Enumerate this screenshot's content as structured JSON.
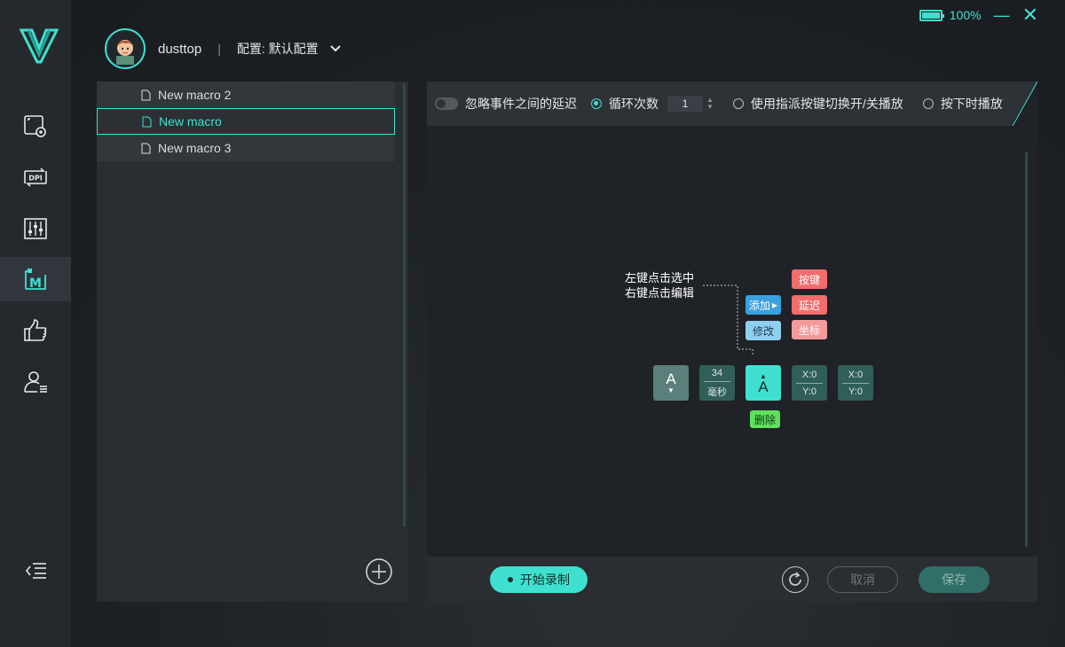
{
  "app": {
    "battery_percent": 100,
    "battery_label": "100%",
    "minimize_icon": "minimize-icon",
    "close_icon": "close-icon",
    "accent_color": "#3fe0cf"
  },
  "profile": {
    "username": "dusttop",
    "separator": "|",
    "config_label": "配置: 默认配置"
  },
  "sidebar": {
    "items": [
      {
        "name": "mouse-settings",
        "icon": "screen-gear-icon"
      },
      {
        "name": "dpi",
        "icon": "dpi-icon"
      },
      {
        "name": "sliders",
        "icon": "equalizer-icon"
      },
      {
        "name": "macro",
        "icon": "macro-icon",
        "active": true
      },
      {
        "name": "like",
        "icon": "thumbs-up-icon"
      },
      {
        "name": "user",
        "icon": "user-settings-icon"
      }
    ],
    "collapse_icon": "collapse-menu-icon"
  },
  "macros": {
    "items": [
      {
        "label": "New macro 2",
        "selected": false
      },
      {
        "label": "New macro",
        "selected": true
      },
      {
        "label": "New macro 3",
        "selected": false
      }
    ]
  },
  "options": {
    "ignore_delay_label": "忽略事件之间的延迟",
    "loop_label": "循环次数",
    "loop_count": "1",
    "toggle_play_label": "使用指派按键切换开/关播放",
    "hold_play_label": "按下时播放"
  },
  "editor": {
    "hint_line1": "左键点击选中",
    "hint_line2": "右键点击编辑",
    "add_label": "添加",
    "modify_label": "修改",
    "delete_label": "删除",
    "menu_key": "按键",
    "menu_delay": "延迟",
    "menu_coord": "坐标",
    "nodes": {
      "key1": "A",
      "delay_value": "34",
      "delay_unit": "毫秒",
      "key2": "A",
      "coord1_x": "X:0",
      "coord1_y": "Y:0",
      "coord2_x": "X:0",
      "coord2_y": "Y:0"
    }
  },
  "footer": {
    "record_label": "开始录制",
    "cancel_label": "取消",
    "save_label": "保存"
  }
}
